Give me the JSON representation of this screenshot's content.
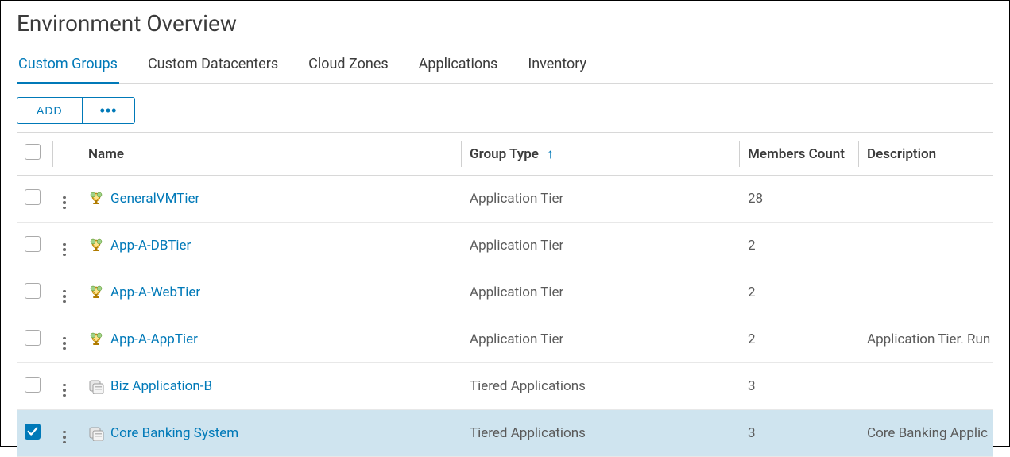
{
  "page_title": "Environment Overview",
  "tabs": [
    {
      "label": "Custom Groups",
      "active": true
    },
    {
      "label": "Custom Datacenters",
      "active": false
    },
    {
      "label": "Cloud Zones",
      "active": false
    },
    {
      "label": "Applications",
      "active": false
    },
    {
      "label": "Inventory",
      "active": false
    }
  ],
  "toolbar": {
    "add_label": "ADD",
    "more_label": "•••"
  },
  "columns": {
    "name": "Name",
    "group_type": "Group Type",
    "members_count": "Members Count",
    "description": "Description",
    "sort_column": "group_type",
    "sort_direction": "asc"
  },
  "rows": [
    {
      "checked": false,
      "icon": "tier",
      "name": "GeneralVMTier",
      "group_type": "Application Tier",
      "members_count": "28",
      "description": ""
    },
    {
      "checked": false,
      "icon": "tier",
      "name": "App-A-DBTier",
      "group_type": "Application Tier",
      "members_count": "2",
      "description": ""
    },
    {
      "checked": false,
      "icon": "tier",
      "name": "App-A-WebTier",
      "group_type": "Application Tier",
      "members_count": "2",
      "description": ""
    },
    {
      "checked": false,
      "icon": "tier",
      "name": "App-A-AppTier",
      "group_type": "Application Tier",
      "members_count": "2",
      "description": "Application Tier. Run"
    },
    {
      "checked": false,
      "icon": "app",
      "name": "Biz Application-B",
      "group_type": "Tiered Applications",
      "members_count": "3",
      "description": ""
    },
    {
      "checked": true,
      "icon": "app",
      "name": "Core Banking System",
      "group_type": "Tiered Applications",
      "members_count": "3",
      "description": "Core Banking Applic"
    }
  ]
}
